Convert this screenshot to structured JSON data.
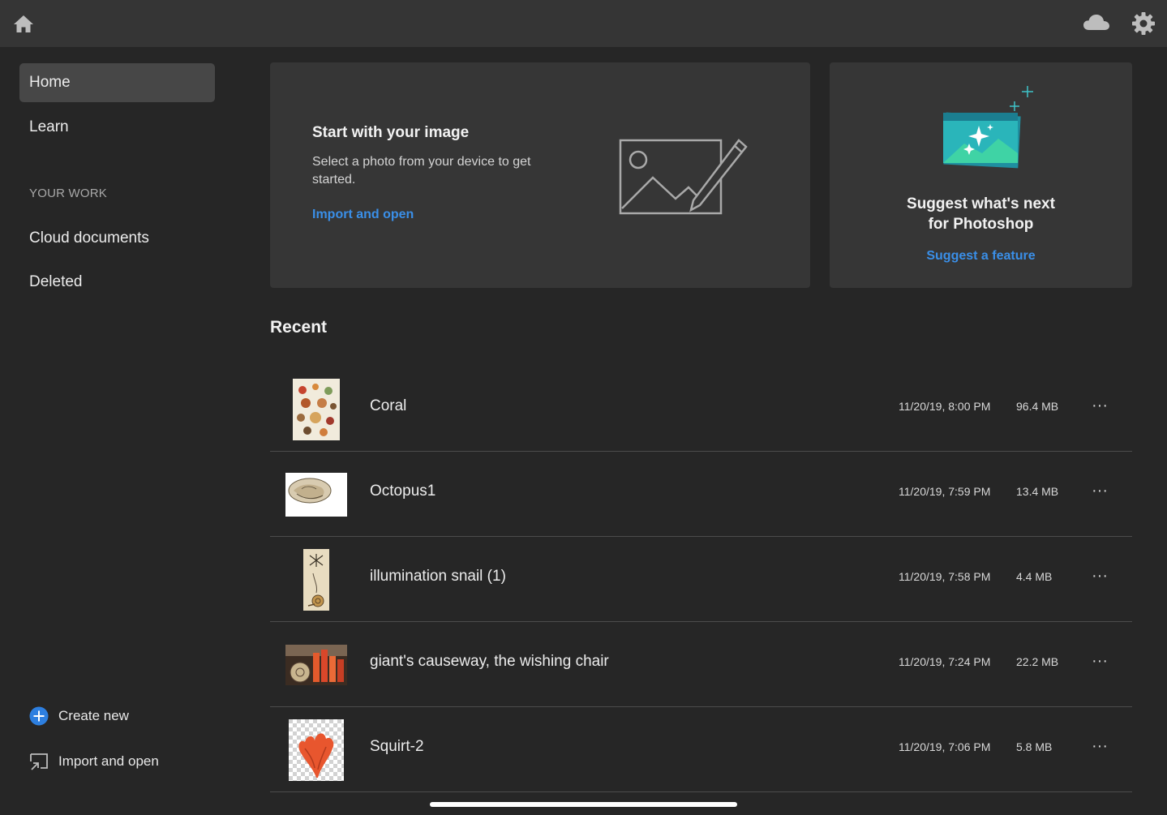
{
  "topbar": {
    "home_icon": "home-icon",
    "cloud_icon": "cloud-icon",
    "settings_icon": "gear-icon"
  },
  "sidebar": {
    "items": [
      {
        "label": "Home",
        "active": true
      },
      {
        "label": "Learn",
        "active": false
      }
    ],
    "section_label": "YOUR WORK",
    "work_items": [
      {
        "label": "Cloud documents"
      },
      {
        "label": "Deleted"
      }
    ],
    "create_new": "Create new",
    "import_open": "Import and open"
  },
  "start_card": {
    "title": "Start with your image",
    "description": "Select a photo from your device to get started.",
    "link": "Import and open"
  },
  "suggest_card": {
    "title_line1": "Suggest what's next",
    "title_line2": "for Photoshop",
    "link": "Suggest a feature"
  },
  "recent": {
    "heading": "Recent",
    "files": [
      {
        "name": "Coral",
        "date": "11/20/19, 8:00 PM",
        "size": "96.4 MB"
      },
      {
        "name": "Octopus1",
        "date": "11/20/19, 7:59 PM",
        "size": "13.4 MB"
      },
      {
        "name": "illumination snail (1)",
        "date": "11/20/19, 7:58 PM",
        "size": "4.4 MB"
      },
      {
        "name": "giant's causeway, the wishing chair",
        "date": "11/20/19, 7:24 PM",
        "size": "22.2 MB"
      },
      {
        "name": "Squirt-2",
        "date": "11/20/19, 7:06 PM",
        "size": "5.8 MB"
      }
    ],
    "more_label": "···"
  },
  "colors": {
    "background": "#262626",
    "topbar": "#353535",
    "card": "#363636",
    "accent_link": "#3a8fe8",
    "create_icon": "#2d7fe0"
  }
}
